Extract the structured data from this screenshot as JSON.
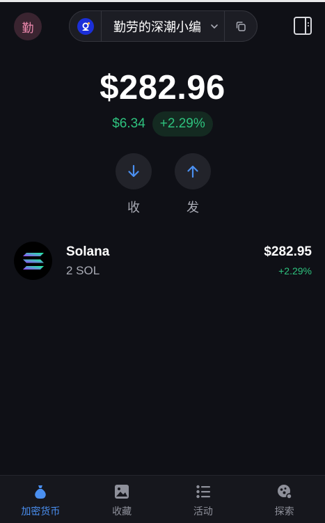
{
  "header": {
    "avatar_char": "勤",
    "account_name": "勤劳的深潮小编",
    "icons": {
      "account": "astronaut-icon",
      "chevron": "chevron-down-icon",
      "copy": "copy-icon",
      "side_panel": "side-panel-icon"
    }
  },
  "wallet": {
    "balance": "$282.96",
    "change_amount": "$6.34",
    "change_percent": "+2.29%"
  },
  "actions": [
    {
      "label": "收",
      "icon": "arrow-down-icon"
    },
    {
      "label": "发",
      "icon": "arrow-up-icon"
    }
  ],
  "tokens": [
    {
      "name": "Solana",
      "amount": "2 SOL",
      "value": "$282.95",
      "change": "+2.29%",
      "icon": "solana-logo-icon"
    }
  ],
  "nav": {
    "items": [
      {
        "label": "加密货币",
        "icon": "money-bag-icon",
        "active": true
      },
      {
        "label": "收藏",
        "icon": "image-icon",
        "active": false
      },
      {
        "label": "活动",
        "icon": "list-icon",
        "active": false
      },
      {
        "label": "探索",
        "icon": "explore-icon",
        "active": false
      }
    ]
  },
  "colors": {
    "background": "#0f1016",
    "positive": "#2ec27e",
    "accent": "#4a8ff0",
    "muted_text": "#a9abb5"
  }
}
